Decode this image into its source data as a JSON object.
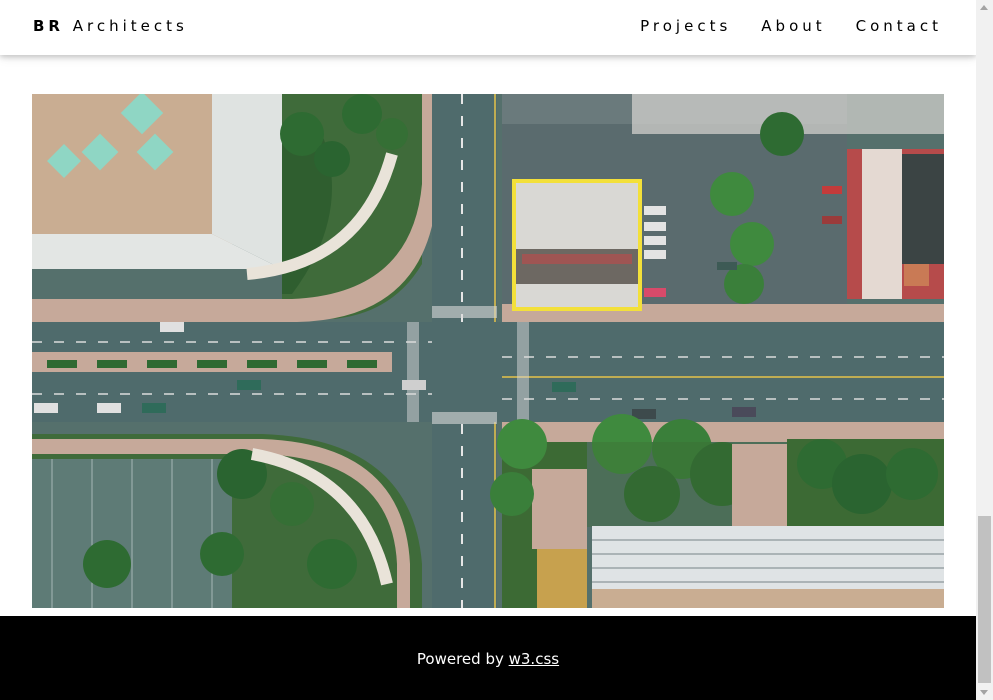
{
  "navbar": {
    "brand_bold": "BR",
    "brand_rest": " Architects",
    "links": [
      "Projects",
      "About",
      "Contact"
    ]
  },
  "hero": {
    "alt": "Aerial view of a city intersection"
  },
  "footer": {
    "prefix": "Powered by ",
    "link_text": "w3.css"
  },
  "colors": {
    "highlight_box": "#f3e03a",
    "footer_bg": "#000000",
    "road": "#4f6b6c",
    "sidewalk": "#c6a99a",
    "grass": "#3f6b3a",
    "tree": "#2e6b32"
  }
}
